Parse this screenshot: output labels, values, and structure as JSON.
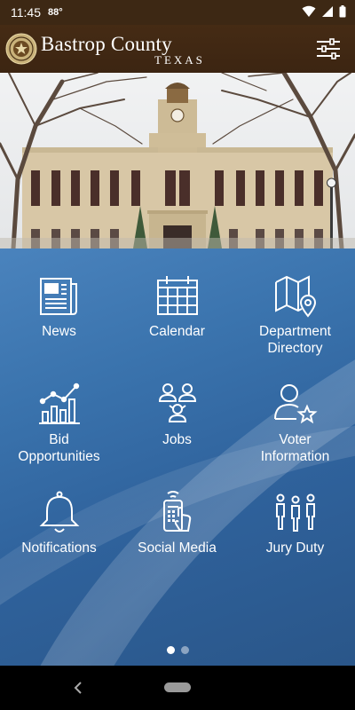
{
  "status": {
    "time": "11:45",
    "temperature": "88°"
  },
  "header": {
    "brand_name": "Bastrop County",
    "brand_sub": "TEXAS",
    "menu_icon": "sliders-icon"
  },
  "tiles": [
    {
      "label": "News",
      "icon": "newspaper-icon"
    },
    {
      "label": "Calendar",
      "icon": "calendar-icon"
    },
    {
      "label": "Department\nDirectory",
      "icon": "map-pin-icon"
    },
    {
      "label": "Bid\nOpportunities",
      "icon": "bar-chart-icon"
    },
    {
      "label": "Jobs",
      "icon": "people-icon"
    },
    {
      "label": "Voter\nInformation",
      "icon": "user-star-icon"
    },
    {
      "label": "Notifications",
      "icon": "bell-icon"
    },
    {
      "label": "Social Media",
      "icon": "phone-tap-icon"
    },
    {
      "label": "Jury Duty",
      "icon": "group-icon"
    }
  ],
  "pager": {
    "pages": 2,
    "active": 1
  },
  "colors": {
    "header": "#452b14",
    "panel": "#3a73ad",
    "icon_stroke": "#ffffff"
  }
}
